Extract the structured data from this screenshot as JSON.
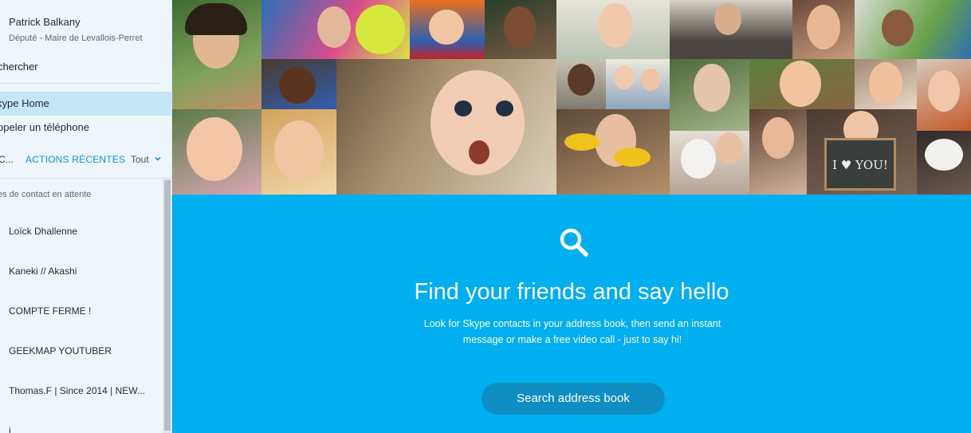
{
  "profile": {
    "name": "Patrick Balkany",
    "mood": "Député - Maire de Levallois-Perret"
  },
  "nav": {
    "search_label": "chercher",
    "home_label": "kype Home",
    "call_label": "ppeler un téléphone"
  },
  "tabs": {
    "contacts_label": "C...",
    "recent_label": "ACTIONS RÉCENTES",
    "filter_label": "Tout"
  },
  "pending_label": "es de contact en attente",
  "contacts": [
    {
      "name": "Loïck Dhallenne"
    },
    {
      "name": "Kaneki // Akashi"
    },
    {
      "name": "COMPTE FERME !"
    },
    {
      "name": "GEEKMAP YOUTUBER"
    },
    {
      "name": "Thomas.F | Since 2014 | NEW..."
    },
    {
      "name": "i"
    }
  ],
  "main": {
    "headline": "Find your friends and say hello",
    "subtext": "Look for Skype contacts in your address book, then send an instant message or make a free video call - just to say hi!",
    "search_button": "Search address book"
  },
  "collage_text": {
    "chalkboard": "I ♥ YOU!"
  },
  "colors": {
    "accent": "#00aff0",
    "button": "#0f8ec4",
    "highlight": "#c4e6f7",
    "link": "#0b97d6"
  },
  "icons": {
    "find": "search-icon",
    "filter": "chevron-down-icon"
  }
}
